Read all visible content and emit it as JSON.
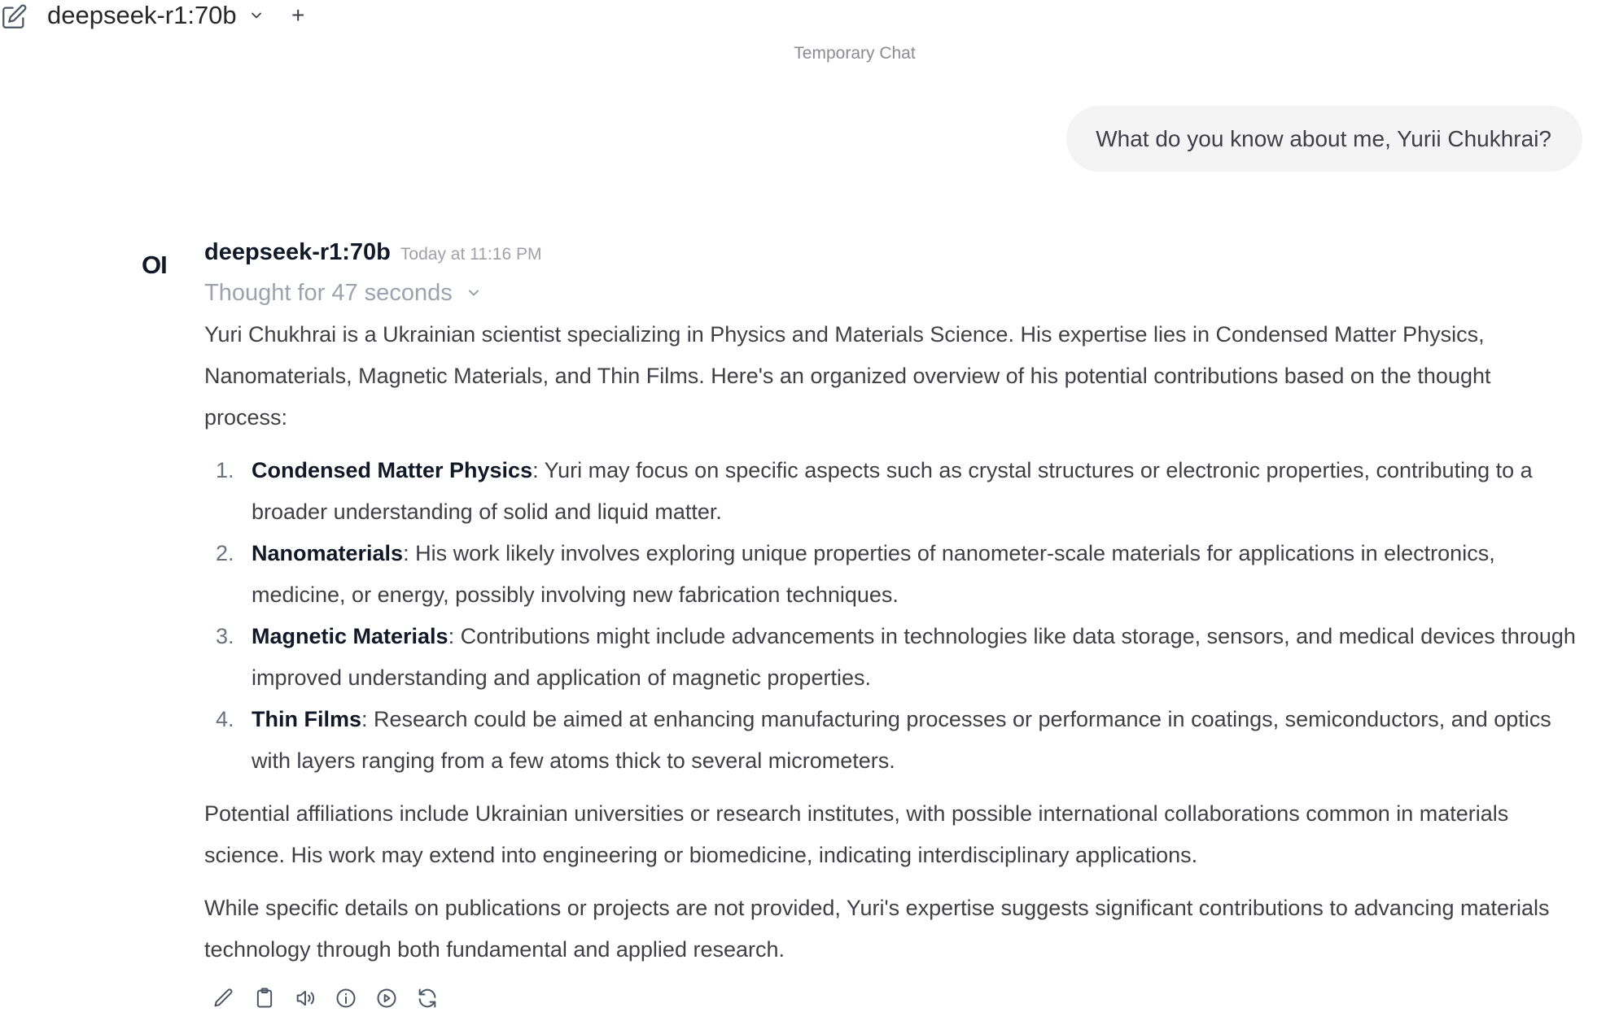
{
  "header": {
    "model_name": "deepseek-r1:70b",
    "add_label": "+",
    "temporary_label": "Temporary Chat"
  },
  "user_message": "What do you know about me, Yurii Chukhrai?",
  "assistant": {
    "avatar": "OI",
    "model_name": "deepseek-r1:70b",
    "timestamp": "Today at 11:16 PM",
    "thought_label": "Thought for 47 seconds",
    "intro": "Yuri Chukhrai is a Ukrainian scientist specializing in Physics and Materials Science. His expertise lies in Condensed Matter Physics, Nanomaterials, Magnetic Materials, and Thin Films. Here's an organized overview of his potential contributions based on the thought process:",
    "items": [
      {
        "num": "1.",
        "title": "Condensed Matter Physics",
        "text": ": Yuri may focus on specific aspects such as crystal structures or electronic properties, contributing to a broader understanding of solid and liquid matter."
      },
      {
        "num": "2.",
        "title": "Nanomaterials",
        "text": ": His work likely involves exploring unique properties of nanometer-scale materials for applications in electronics, medicine, or energy, possibly involving new fabrication techniques."
      },
      {
        "num": "3.",
        "title": "Magnetic Materials",
        "text": ": Contributions might include advancements in technologies like data storage, sensors, and medical devices through improved understanding and application of magnetic properties."
      },
      {
        "num": "4.",
        "title": "Thin Films",
        "text": ": Research could be aimed at enhancing manufacturing processes or performance in coatings, semiconductors, and optics with layers ranging from a few atoms thick to several micrometers."
      }
    ],
    "para2": "Potential affiliations include Ukrainian universities or research institutes, with possible international collaborations common in materials science. His work may extend into engineering or biomedicine, indicating interdisciplinary applications.",
    "para3": "While specific details on publications or projects are not provided, Yuri's expertise suggests significant contributions to advancing materials technology through both fundamental and applied research."
  },
  "actions": [
    "edit-icon",
    "copy-icon",
    "read-aloud-icon",
    "info-icon",
    "continue-icon",
    "regenerate-icon"
  ]
}
